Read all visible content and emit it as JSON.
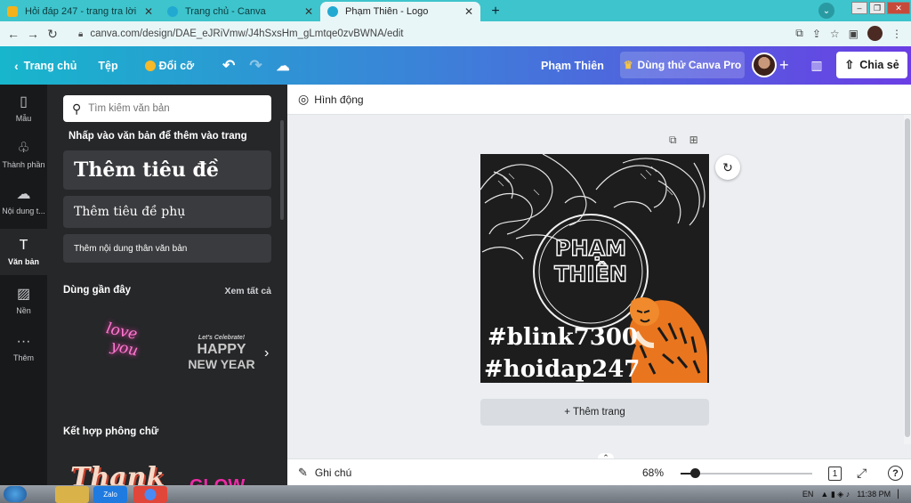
{
  "browser": {
    "tabs": [
      {
        "title": "Hỏi đáp 247 - trang tra lời",
        "fav_color": "#f3b21b",
        "active": false
      },
      {
        "title": "Trang chủ - Canva",
        "fav_color": "#22a9d2",
        "active": false
      },
      {
        "title": "Phạm Thiên - Logo",
        "fav_color": "#22a9d2",
        "active": true
      }
    ],
    "url": "canva.com/design/DAE_eJRiVmw/J4hSxsHm_gLmtqe0zvBWNA/edit"
  },
  "header": {
    "home_label": "Trang chủ",
    "file_label": "Tệp",
    "resize_label": "Đổi cỡ",
    "user_name": "Phạm Thiên",
    "trial_label": "Dùng thử Canva Pro",
    "share_label": "Chia sẻ"
  },
  "rail": [
    {
      "label": "Mẫu",
      "icon": "template-icon"
    },
    {
      "label": "Thành phần",
      "icon": "elements-icon"
    },
    {
      "label": "Nội dung t...",
      "icon": "upload-icon"
    },
    {
      "label": "Văn bản",
      "icon": "text-icon",
      "active": true
    },
    {
      "label": "Nền",
      "icon": "background-icon"
    },
    {
      "label": "Thêm",
      "icon": "more-icon"
    }
  ],
  "panel": {
    "search_placeholder": "Tìm kiếm văn bản",
    "click_hint": "Nhấp vào văn bản để thêm vào trang",
    "heading_btn": "Thêm tiêu đề",
    "subheading_btn": "Thêm tiêu đề phụ",
    "body_btn": "Thêm nội dung thân văn bản",
    "recent_title": "Dùng gần đây",
    "see_all": "Xem tất cả",
    "recent_items": {
      "love_line1": "love",
      "love_line2": "you",
      "ny_small": "Let's Celebrate!",
      "ny_line1": "HAPPY",
      "ny_line2": "NEW YEAR"
    },
    "combo_title": "Kết hợp phông chữ",
    "combo_items": {
      "thank": "Thank",
      "glow": "GLOW"
    }
  },
  "canvas": {
    "animate_label": "Hình động",
    "logo_line1": "PHẠM",
    "logo_line2": "THIÊN",
    "hashtag1": "#blink7300",
    "hashtag2": "#hoidap247",
    "add_page": "+ Thêm trang"
  },
  "bottom": {
    "notes_label": "Ghi chú",
    "zoom": "68%",
    "page_count": "1"
  },
  "taskbar": {
    "lang": "EN",
    "time": "11:38 PM",
    "zalo": "Zalo"
  }
}
